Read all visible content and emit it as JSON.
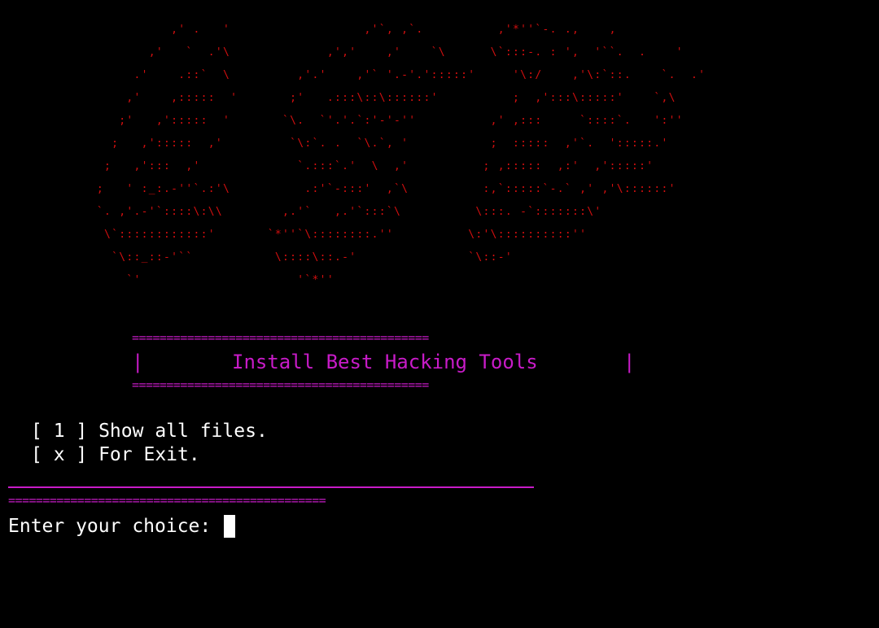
{
  "art": {
    "lines": [
      "                 ,' .   '                  ,'`, ,`.          ,'*''`-. .,    ,",
      "              ,'   `  .'\\             ,','    ,'    `\\      \\`:::-. : ',  '``.  .    '",
      "            .'    .::`  \\         ,'.'    ,'` '.-'.':::::'     '\\:/    ,'\\:`::.    `.  .'",
      "           ,'    ,:::::  '       ;'   .:::\\::\\::::::'          ;  ,':::\\:::::'    `,\\",
      "          ;'   ,':::::  '       `\\.  `'.'.`:'-'-''          ,' ,:::     `::::`.   ':''",
      "         ;   ,':::::  ,'         `\\:`. .  `\\.`, '           ;  :::::  ,'`.  ':::::.'",
      "        ;   ,':::  ,'             `.:::`.'  \\  ,'          ; ,:::::  ,:'  ,':::::'",
      "       ;   ' :_:.-''`.:'\\          .:'`-:::'  ,`\\          :,`:::::`-.` ,' ,'\\::::::'",
      "       `. ,'.-'`::::\\:\\\\        ,.'`   ,.'`:::`\\          \\:::. -`:::::::\\'",
      "        \\`::::::::::::'       `*''`\\::::::::.''          \\:'\\::::::::::''",
      "         `\\::_::-'``           \\::::\\::.-'               `\\::-'",
      "           `'                     '`*''"
    ],
    "stars": [
      "*",
      "*",
      "*"
    ]
  },
  "banner": {
    "rule_top": "===========================================",
    "bar_left": "|",
    "title": "Install Best Hacking Tools",
    "bar_right": "|",
    "rule_bottom": "==========================================="
  },
  "menu": {
    "items": [
      {
        "label": "[ 1 ] Show all files."
      },
      {
        "label": "[ x ] For Exit."
      }
    ]
  },
  "divider": {
    "rule": "=============================================="
  },
  "prompt": {
    "label": "Enter your choice: "
  },
  "colors": {
    "background": "#000000",
    "art": "#d40f0f",
    "accent": "#c81bc8",
    "text": "#ffffff"
  }
}
